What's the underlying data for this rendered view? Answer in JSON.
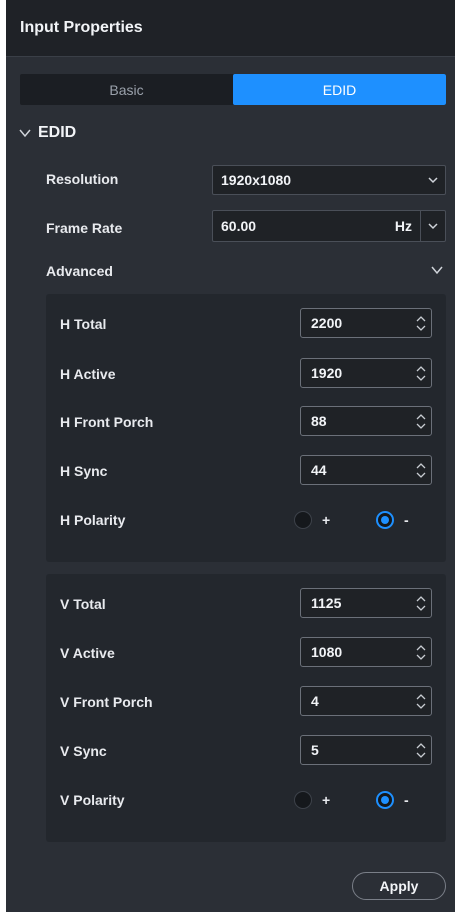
{
  "header": {
    "title": "Input Properties"
  },
  "tabs": [
    {
      "label": "Basic",
      "active": false
    },
    {
      "label": "EDID",
      "active": true
    }
  ],
  "section": {
    "title": "EDID"
  },
  "resolution": {
    "label": "Resolution",
    "value": "1920x1080"
  },
  "frame_rate": {
    "label": "Frame Rate",
    "value": "60.00",
    "unit": "Hz"
  },
  "advanced": {
    "label": "Advanced"
  },
  "horizontal": {
    "total": {
      "label": "H Total",
      "value": "2200"
    },
    "active": {
      "label": "H Active",
      "value": "1920"
    },
    "front_porch": {
      "label": "H Front Porch",
      "value": "88"
    },
    "sync": {
      "label": "H Sync",
      "value": "44"
    },
    "polarity": {
      "label": "H Polarity",
      "plus": "+",
      "minus": "-",
      "selected": "-"
    }
  },
  "vertical": {
    "total": {
      "label": "V Total",
      "value": "1125"
    },
    "active": {
      "label": "V Active",
      "value": "1080"
    },
    "front_porch": {
      "label": "V Front Porch",
      "value": "4"
    },
    "sync": {
      "label": "V Sync",
      "value": "5"
    },
    "polarity": {
      "label": "V Polarity",
      "plus": "+",
      "minus": "-",
      "selected": "-"
    }
  },
  "apply_label": "Apply",
  "colors": {
    "accent": "#1e90ff",
    "panel": "#2b2f36",
    "header": "#1f2227"
  }
}
